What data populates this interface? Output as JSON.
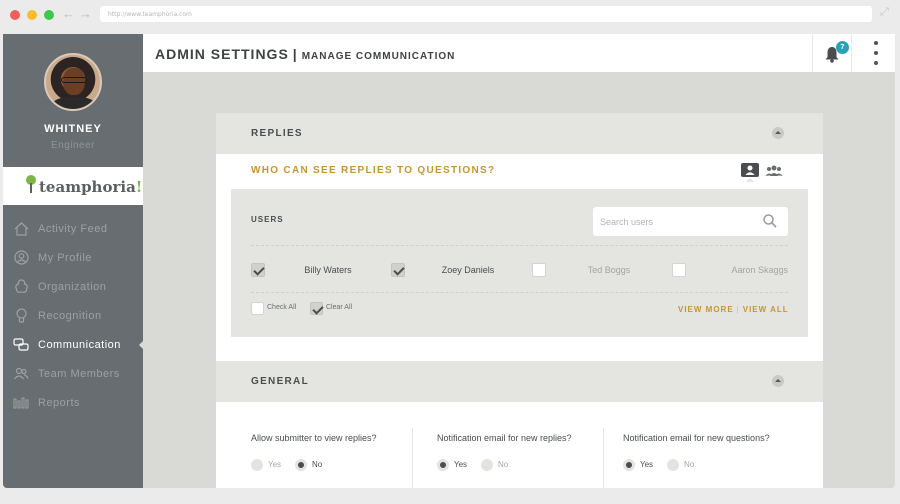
{
  "browser": {
    "url": "http://www.teamphoria.com"
  },
  "user": {
    "name": "WHITNEY",
    "role": "Engineer"
  },
  "logo": {
    "text": "teamphoria",
    "mark": "!"
  },
  "sidebar": {
    "items": [
      {
        "label": "Activity Feed",
        "icon": "home-icon",
        "active": false
      },
      {
        "label": "My Profile",
        "icon": "profile-icon",
        "active": false
      },
      {
        "label": "Organization",
        "icon": "organization-icon",
        "active": false
      },
      {
        "label": "Recognition",
        "icon": "recognition-icon",
        "active": false
      },
      {
        "label": "Communication",
        "icon": "communication-icon",
        "active": true
      },
      {
        "label": "Team Members",
        "icon": "team-members-icon",
        "active": false
      },
      {
        "label": "Reports",
        "icon": "reports-icon",
        "active": false
      }
    ]
  },
  "header": {
    "title": "ADMIN SETTINGS",
    "separator": "|",
    "subtitle": "MANAGE COMMUNICATION",
    "notification_count": "7"
  },
  "replies": {
    "title": "REPLIES",
    "question": "WHO CAN SEE REPLIES TO QUESTIONS?",
    "users_label": "USERS",
    "search_placeholder": "Search users",
    "users": [
      {
        "name": "Billy Waters",
        "checked": true
      },
      {
        "name": "Zoey Daniels",
        "checked": true
      },
      {
        "name": "Ted Boggs",
        "checked": false
      },
      {
        "name": "Aaron Skaggs",
        "checked": false
      }
    ],
    "check_all": "Check All",
    "clear_all": "Clear All",
    "view_more": "VIEW MORE",
    "view_divider": "|",
    "view_all": "VIEW ALL"
  },
  "general": {
    "title": "GENERAL",
    "settings": [
      {
        "question": "Allow submitter to view replies?",
        "yes": "Yes",
        "no": "No",
        "selected": "No"
      },
      {
        "question": "Notification email for new replies?",
        "yes": "Yes",
        "no": "No",
        "selected": "Yes"
      },
      {
        "question": "Notification email for new questions?",
        "yes": "Yes",
        "no": "No",
        "selected": "Yes"
      }
    ]
  },
  "colors": {
    "accent_gold": "#c5962d",
    "sidebar_bg": "#676d71",
    "badge": "#2aa1b7",
    "logo_green": "#7ab648"
  }
}
